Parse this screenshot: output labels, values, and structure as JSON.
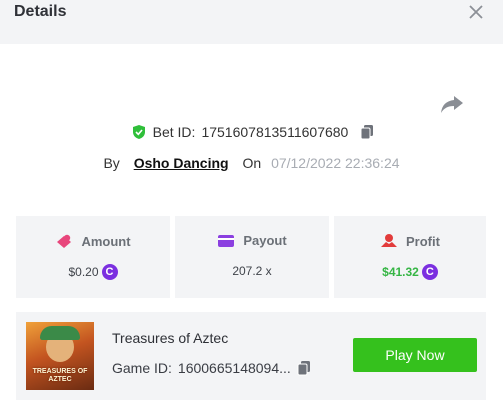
{
  "header": {
    "title": "Details"
  },
  "bet": {
    "label": "Bet ID:",
    "id": "1751607813511607680",
    "by_label": "By",
    "user": "Osho Dancing",
    "on_label": "On",
    "datetime": "07/12/2022 22:36:24"
  },
  "stats": {
    "amount": {
      "label": "Amount",
      "value": "$0.20",
      "icon_color": "#e8467c"
    },
    "payout": {
      "label": "Payout",
      "value": "207.2 x",
      "icon_color": "#8b3fe0"
    },
    "profit": {
      "label": "Profit",
      "value": "$41.32",
      "value_color": "#35b544",
      "icon_color": "#e23b3b"
    }
  },
  "currency_icon": {
    "name": "coin-icon",
    "glyph": "C",
    "color": "#7b2fe0"
  },
  "game": {
    "name": "Treasures of Aztec",
    "id_label": "Game ID:",
    "id": "1600665148094...",
    "thumbnail_text": "TREASURES OF AZTEC",
    "play_label": "Play Now",
    "play_color": "#35c11d"
  },
  "colors": {
    "verified": "#2fbf3a",
    "header_bg": "#f3f4f6"
  }
}
